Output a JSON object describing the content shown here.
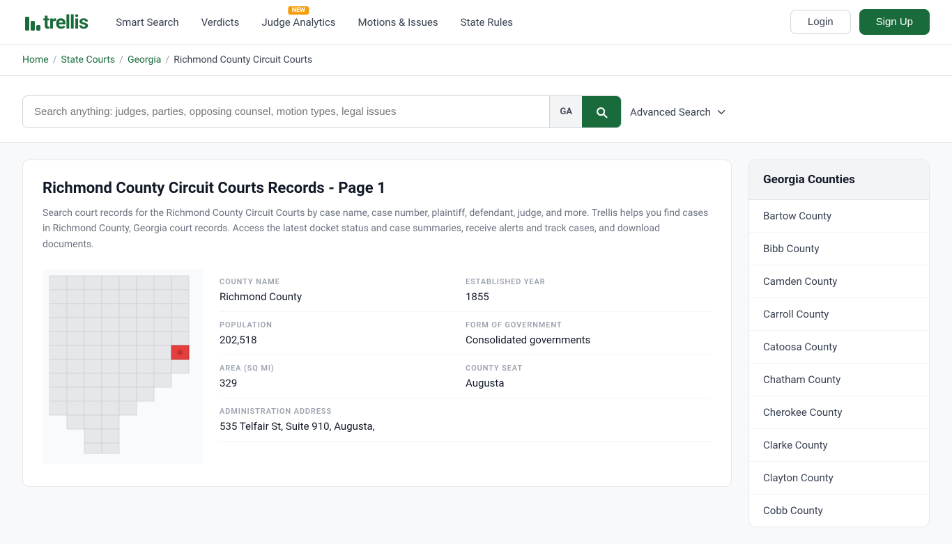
{
  "nav": {
    "logo": "trellis",
    "links": [
      {
        "label": "Smart Search",
        "badge": null
      },
      {
        "label": "Verdicts",
        "badge": null
      },
      {
        "label": "Judge Analytics",
        "badge": "NEW"
      },
      {
        "label": "Motions & Issues",
        "badge": null
      },
      {
        "label": "State Rules",
        "badge": null
      }
    ],
    "login_label": "Login",
    "signup_label": "Sign Up"
  },
  "breadcrumb": {
    "home": "Home",
    "state_courts": "State Courts",
    "state": "Georgia",
    "current": "Richmond County Circuit Courts"
  },
  "search": {
    "placeholder": "Search anything: judges, parties, opposing counsel, motion types, legal issues",
    "state_code": "GA",
    "advanced_label": "Advanced Search"
  },
  "content": {
    "title": "Richmond County Circuit Courts Records - Page 1",
    "description": "Search court records for the Richmond County Circuit Courts by case name, case number, plaintiff, defendant, judge, and more. Trellis helps you find cases in Richmond County, Georgia court records. Access the latest docket status and case summaries, receive alerts and track cases, and download documents.",
    "county": {
      "name_label": "COUNTY NAME",
      "name_value": "Richmond County",
      "established_label": "ESTABLISHED YEAR",
      "established_value": "1855",
      "population_label": "POPULATION",
      "population_value": "202,518",
      "form_of_gov_label": "FORM OF GOVERNMENT",
      "form_of_gov_value": "Consolidated governments",
      "area_label": "AREA (SQ MI)",
      "area_value": "329",
      "county_seat_label": "COUNTY SEAT",
      "county_seat_value": "Augusta",
      "address_label": "ADMINISTRATION ADDRESS",
      "address_value": "535 Telfair St, Suite 910, Augusta,"
    }
  },
  "sidebar": {
    "header": "Georgia Counties",
    "items": [
      "Bartow County",
      "Bibb County",
      "Camden County",
      "Carroll County",
      "Catoosa County",
      "Chatham County",
      "Cherokee County",
      "Clarke County",
      "Clayton County",
      "Cobb County"
    ]
  }
}
